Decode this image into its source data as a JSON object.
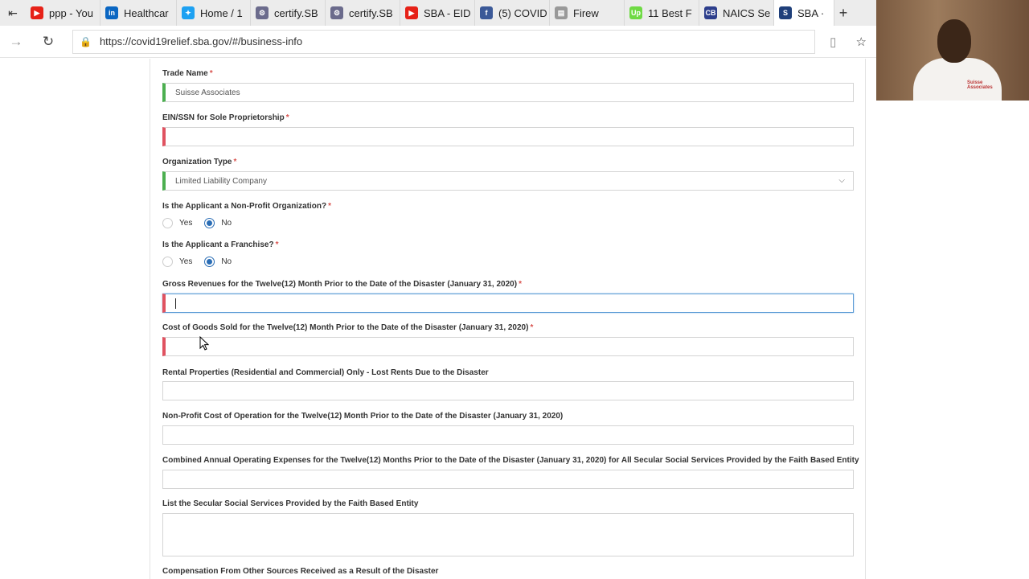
{
  "browser": {
    "tabs": [
      {
        "label": "ppp - You",
        "icon": "youtube-icon",
        "color": "#e62117",
        "glyph": "▶"
      },
      {
        "label": "Healthcar",
        "icon": "linkedin-icon",
        "color": "#0a66c2",
        "glyph": "in"
      },
      {
        "label": "Home / 1",
        "icon": "twitter-icon",
        "color": "#1da1f2",
        "glyph": "✦"
      },
      {
        "label": "certify.SB",
        "icon": "certify-icon",
        "color": "#6b6b8c",
        "glyph": "⚙"
      },
      {
        "label": "certify.SB",
        "icon": "certify-icon",
        "color": "#6b6b8c",
        "glyph": "⚙"
      },
      {
        "label": "SBA - EID",
        "icon": "youtube-icon",
        "color": "#e62117",
        "glyph": "▶"
      },
      {
        "label": "(5) COVID",
        "icon": "facebook-icon",
        "color": "#3b5998",
        "glyph": "f"
      },
      {
        "label": "Firew",
        "icon": "page-icon",
        "color": "#999999",
        "glyph": "▤"
      },
      {
        "label": "11 Best F",
        "icon": "upwork-icon",
        "color": "#6fda44",
        "glyph": "Up"
      },
      {
        "label": "NAICS Se",
        "icon": "cb-icon",
        "color": "#2d3e8c",
        "glyph": "CB"
      },
      {
        "label": "SBA ·",
        "icon": "sba-icon",
        "color": "#1f3f7a",
        "glyph": "S"
      }
    ],
    "url": "https://covid19relief.sba.gov/#/business-info"
  },
  "form": {
    "trade_name_label": "Trade Name",
    "trade_name_value": "Suisse Associates",
    "ein_label": "EIN/SSN for Sole Proprietorship",
    "ein_value": "",
    "org_type_label": "Organization Type",
    "org_type_value": "Limited Liability Company",
    "nonprofit_label": "Is the Applicant a Non-Profit Organization?",
    "franchise_label": "Is the Applicant a Franchise?",
    "yes_label": "Yes",
    "no_label": "No",
    "nonprofit_selected": "No",
    "franchise_selected": "No",
    "gross_rev_label": "Gross Revenues for the Twelve(12) Month Prior to the Date of the Disaster (January 31, 2020)",
    "cogs_label": "Cost of Goods Sold for the Twelve(12) Month Prior to the Date of the Disaster (January 31, 2020)",
    "rental_label": "Rental Properties (Residential and Commercial) Only - Lost Rents Due to the Disaster",
    "nonprofit_cost_label": "Non-Profit Cost of Operation for the Twelve(12) Month Prior to the Date of the Disaster (January 31, 2020)",
    "combined_label": "Combined Annual Operating Expenses for the Twelve(12) Months Prior to the Date of the Disaster (January 31, 2020) for All Secular Social Services Provided by the Faith Based Entity",
    "secular_label": "List the Secular Social Services Provided by the Faith Based Entity",
    "compensation_label": "Compensation From Other Sources Received as a Result of the Disaster",
    "required_mark": "*"
  },
  "colors": {
    "valid": "#4caf50",
    "invalid": "#e05260",
    "focus": "#5b9bd5",
    "radio": "#2a6db5"
  }
}
